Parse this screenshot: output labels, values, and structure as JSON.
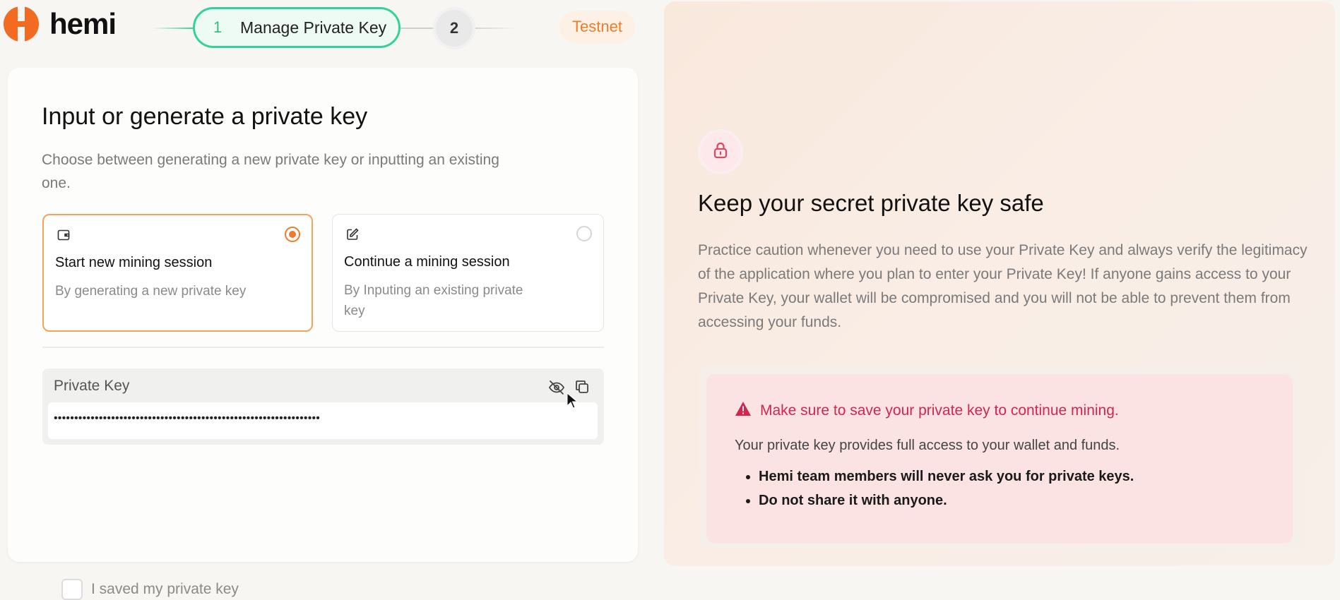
{
  "brand": {
    "name": "hemi",
    "logo_color": "#f26b21"
  },
  "stepper": {
    "steps": [
      {
        "number": "1",
        "label": "Manage Private Key",
        "state": "active"
      },
      {
        "number": "2",
        "label": "",
        "state": "upcoming"
      }
    ],
    "active_color": "#35d19c"
  },
  "network_badge": "Testnet",
  "setup": {
    "title": "Input or generate a private key",
    "subtitle": "Choose between generating a new private key or inputting an existing one.",
    "options": [
      {
        "icon": "wallet-icon",
        "title": "Start new mining session",
        "description": "By generating a new private key",
        "selected": true
      },
      {
        "icon": "edit-icon",
        "title": "Continue a mining session",
        "description": "By Inputing an existing private key",
        "selected": false
      }
    ],
    "private_key": {
      "label": "Private Key",
      "masked_value": "•••••••••••••••••••••••••••••••••••••••••••••••••••••••••••••••••",
      "visibility_icon": "eye-off-icon",
      "copy_icon": "copy-icon"
    },
    "confirm_checkbox": {
      "label": "I saved my private key",
      "checked": false
    }
  },
  "safety": {
    "icon": "lock-icon",
    "title": "Keep your secret private key safe",
    "body": "Practice caution whenever you need to use your Private Key and always verify the legitimacy of the application where you plan to enter your Private Key! If anyone gains access to your Private Key, your wallet will be compromised and you will not be able to prevent them from accessing your funds.",
    "warning": {
      "icon": "warning-icon",
      "title": "Make sure to save your private key to continue mining.",
      "text": "Your private key provides full access to your wallet and funds.",
      "bullets": [
        "Hemi team members will never ask you for private keys.",
        "Do not share it with anyone."
      ],
      "color": "#d1264f"
    }
  },
  "accent_color": "#f07a2a"
}
